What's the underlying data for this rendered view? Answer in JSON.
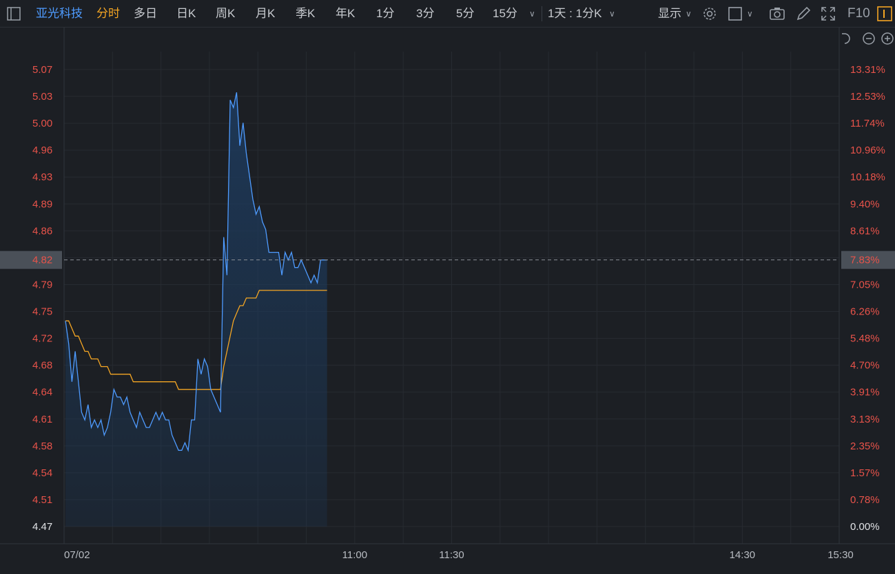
{
  "toolbar": {
    "stock_name": "亚光科技",
    "tabs": [
      "分时",
      "多日",
      "日K",
      "周K",
      "月K",
      "季K",
      "年K",
      "1分",
      "3分",
      "5分",
      "15分"
    ],
    "active_tab": "分时",
    "period_select": "1天 : 1分K",
    "display_label": "显示",
    "f10_label": "F10"
  },
  "colors": {
    "background": "#1c1f24",
    "price_line": "#4e9bff",
    "avg_line": "#f5a623",
    "up_text": "#e8534a",
    "base_text": "#e1e3e6",
    "area_fill": "#1d3a5c"
  },
  "chart_data": {
    "type": "line",
    "x_axis": {
      "start": "09:30",
      "end": "15:00",
      "tick_labels": [
        {
          "time": "09:30",
          "label": "07/02"
        },
        {
          "time": "11:00",
          "label": "11:00"
        },
        {
          "time": "11:30",
          "label": "11:30"
        },
        {
          "time": "14:30",
          "label": "14:30"
        },
        {
          "time": "15:00",
          "label": "15:30"
        }
      ]
    },
    "y_left_ticks": [
      "5.07",
      "5.03",
      "5.00",
      "4.96",
      "4.93",
      "4.89",
      "4.86",
      "4.82",
      "4.79",
      "4.75",
      "4.72",
      "4.68",
      "4.64",
      "4.61",
      "4.58",
      "4.54",
      "4.51",
      "4.47"
    ],
    "y_right_ticks": [
      "13.31%",
      "12.53%",
      "11.74%",
      "10.96%",
      "10.18%",
      "9.40%",
      "8.61%",
      "7.83%",
      "7.05%",
      "6.26%",
      "5.48%",
      "4.70%",
      "3.91%",
      "3.13%",
      "2.35%",
      "1.57%",
      "0.78%",
      "0.00%"
    ],
    "ylim": [
      4.47,
      5.07
    ],
    "base_price": 4.47,
    "current_price": "4.82",
    "current_pct": "7.83%",
    "series": [
      {
        "values": [
          4.74,
          4.71,
          4.66,
          4.7,
          4.66,
          4.62,
          4.61,
          4.63,
          4.6,
          4.61,
          4.6,
          4.61,
          4.59,
          4.6,
          4.62,
          4.65,
          4.64,
          4.64,
          4.63,
          4.64,
          4.62,
          4.61,
          4.6,
          4.62,
          4.61,
          4.6,
          4.6,
          4.61,
          4.62,
          4.61,
          4.62,
          4.61,
          4.61,
          4.59,
          4.58,
          4.57,
          4.57,
          4.58,
          4.57,
          4.61,
          4.61,
          4.69,
          4.67,
          4.69,
          4.68,
          4.65,
          4.64,
          4.63,
          4.62,
          4.85,
          4.8,
          5.03,
          5.02,
          5.04,
          4.97,
          5.0,
          4.96,
          4.93,
          4.9,
          4.88,
          4.89,
          4.87,
          4.86,
          4.83,
          4.83,
          4.83,
          4.83,
          4.8,
          4.83,
          4.82,
          4.83,
          4.81,
          4.81,
          4.82,
          4.81,
          4.8,
          4.79,
          4.8,
          4.79,
          4.82,
          4.82,
          4.82
        ]
      },
      {
        "values": [
          4.74,
          4.74,
          4.73,
          4.72,
          4.72,
          4.71,
          4.7,
          4.7,
          4.69,
          4.69,
          4.69,
          4.68,
          4.68,
          4.68,
          4.67,
          4.67,
          4.67,
          4.67,
          4.67,
          4.67,
          4.67,
          4.66,
          4.66,
          4.66,
          4.66,
          4.66,
          4.66,
          4.66,
          4.66,
          4.66,
          4.66,
          4.66,
          4.66,
          4.66,
          4.66,
          4.65,
          4.65,
          4.65,
          4.65,
          4.65,
          4.65,
          4.65,
          4.65,
          4.65,
          4.65,
          4.65,
          4.65,
          4.65,
          4.65,
          4.68,
          4.7,
          4.72,
          4.74,
          4.75,
          4.76,
          4.76,
          4.77,
          4.77,
          4.77,
          4.77,
          4.78,
          4.78,
          4.78,
          4.78,
          4.78,
          4.78,
          4.78,
          4.78,
          4.78,
          4.78,
          4.78,
          4.78,
          4.78,
          4.78,
          4.78,
          4.78,
          4.78,
          4.78,
          4.78,
          4.78,
          4.78,
          4.78
        ]
      }
    ],
    "grid": true
  }
}
